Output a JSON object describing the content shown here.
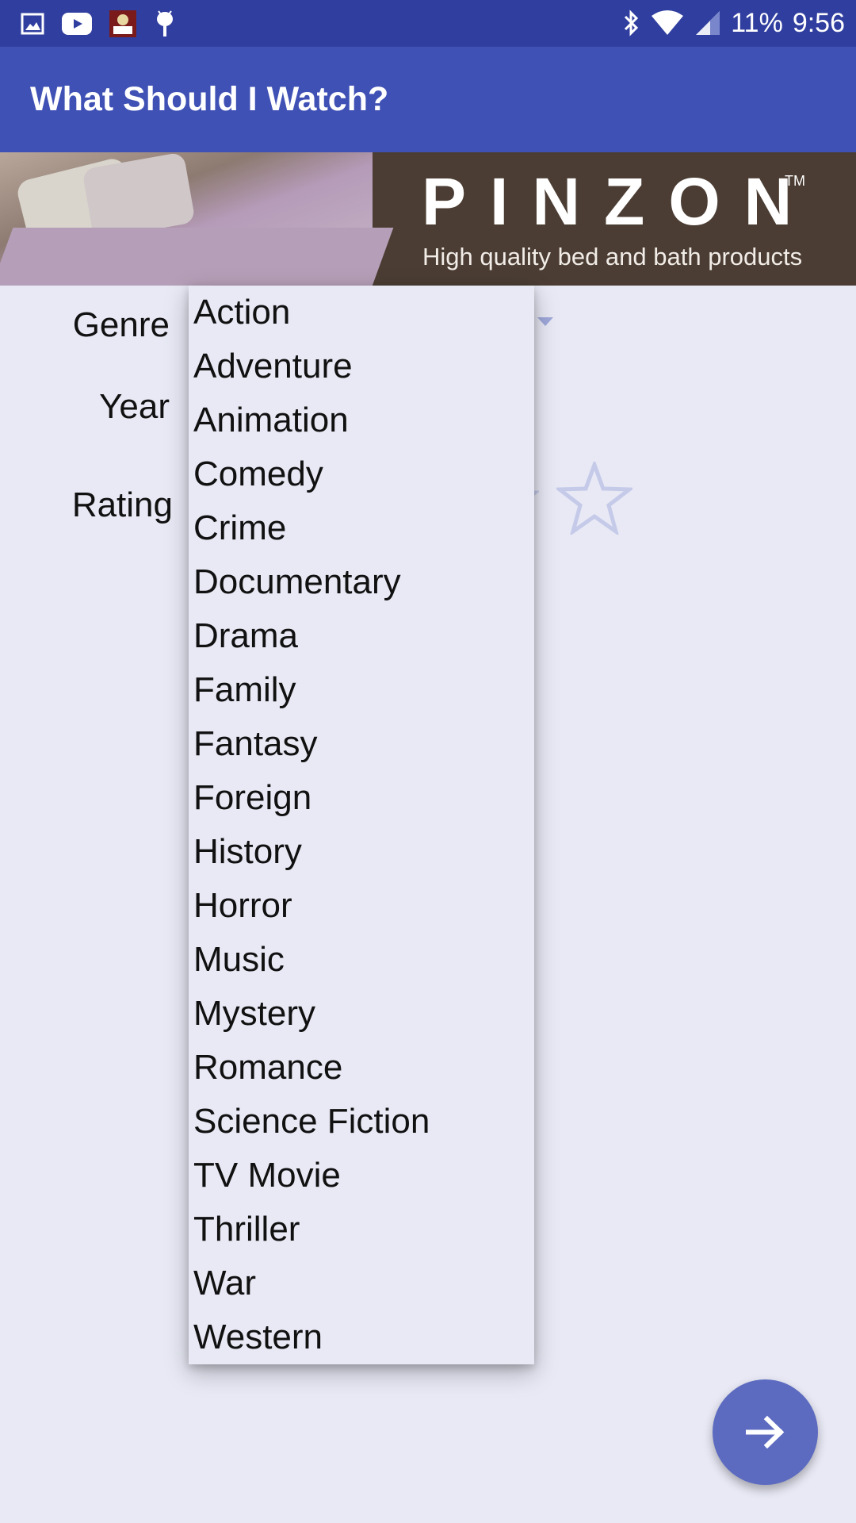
{
  "status_bar": {
    "battery": "11%",
    "time": "9:56",
    "icons": [
      "image-icon",
      "youtube-icon",
      "game-app-icon",
      "android-debug-icon",
      "bluetooth-icon",
      "wifi-icon",
      "signal-icon"
    ]
  },
  "app_bar": {
    "title": "What Should I Watch?"
  },
  "ad": {
    "brand": "PINZON",
    "trademark": "TM",
    "tagline": "High quality bed and bath products"
  },
  "form": {
    "genre_label": "Genre",
    "year_label": "Year",
    "rating_label": "Rating"
  },
  "genre_options": [
    "Action",
    "Adventure",
    "Animation",
    "Comedy",
    "Crime",
    "Documentary",
    "Drama",
    "Family",
    "Fantasy",
    "Foreign",
    "History",
    "Horror",
    "Music",
    "Mystery",
    "Romance",
    "Science Fiction",
    "TV Movie",
    "Thriller",
    "War",
    "Western"
  ],
  "fab": {
    "icon": "arrow-forward-icon"
  },
  "colors": {
    "status_bar": "#303f9f",
    "app_bar": "#3f51b5",
    "fab": "#5c6bc0",
    "background": "#e8e9f5"
  }
}
